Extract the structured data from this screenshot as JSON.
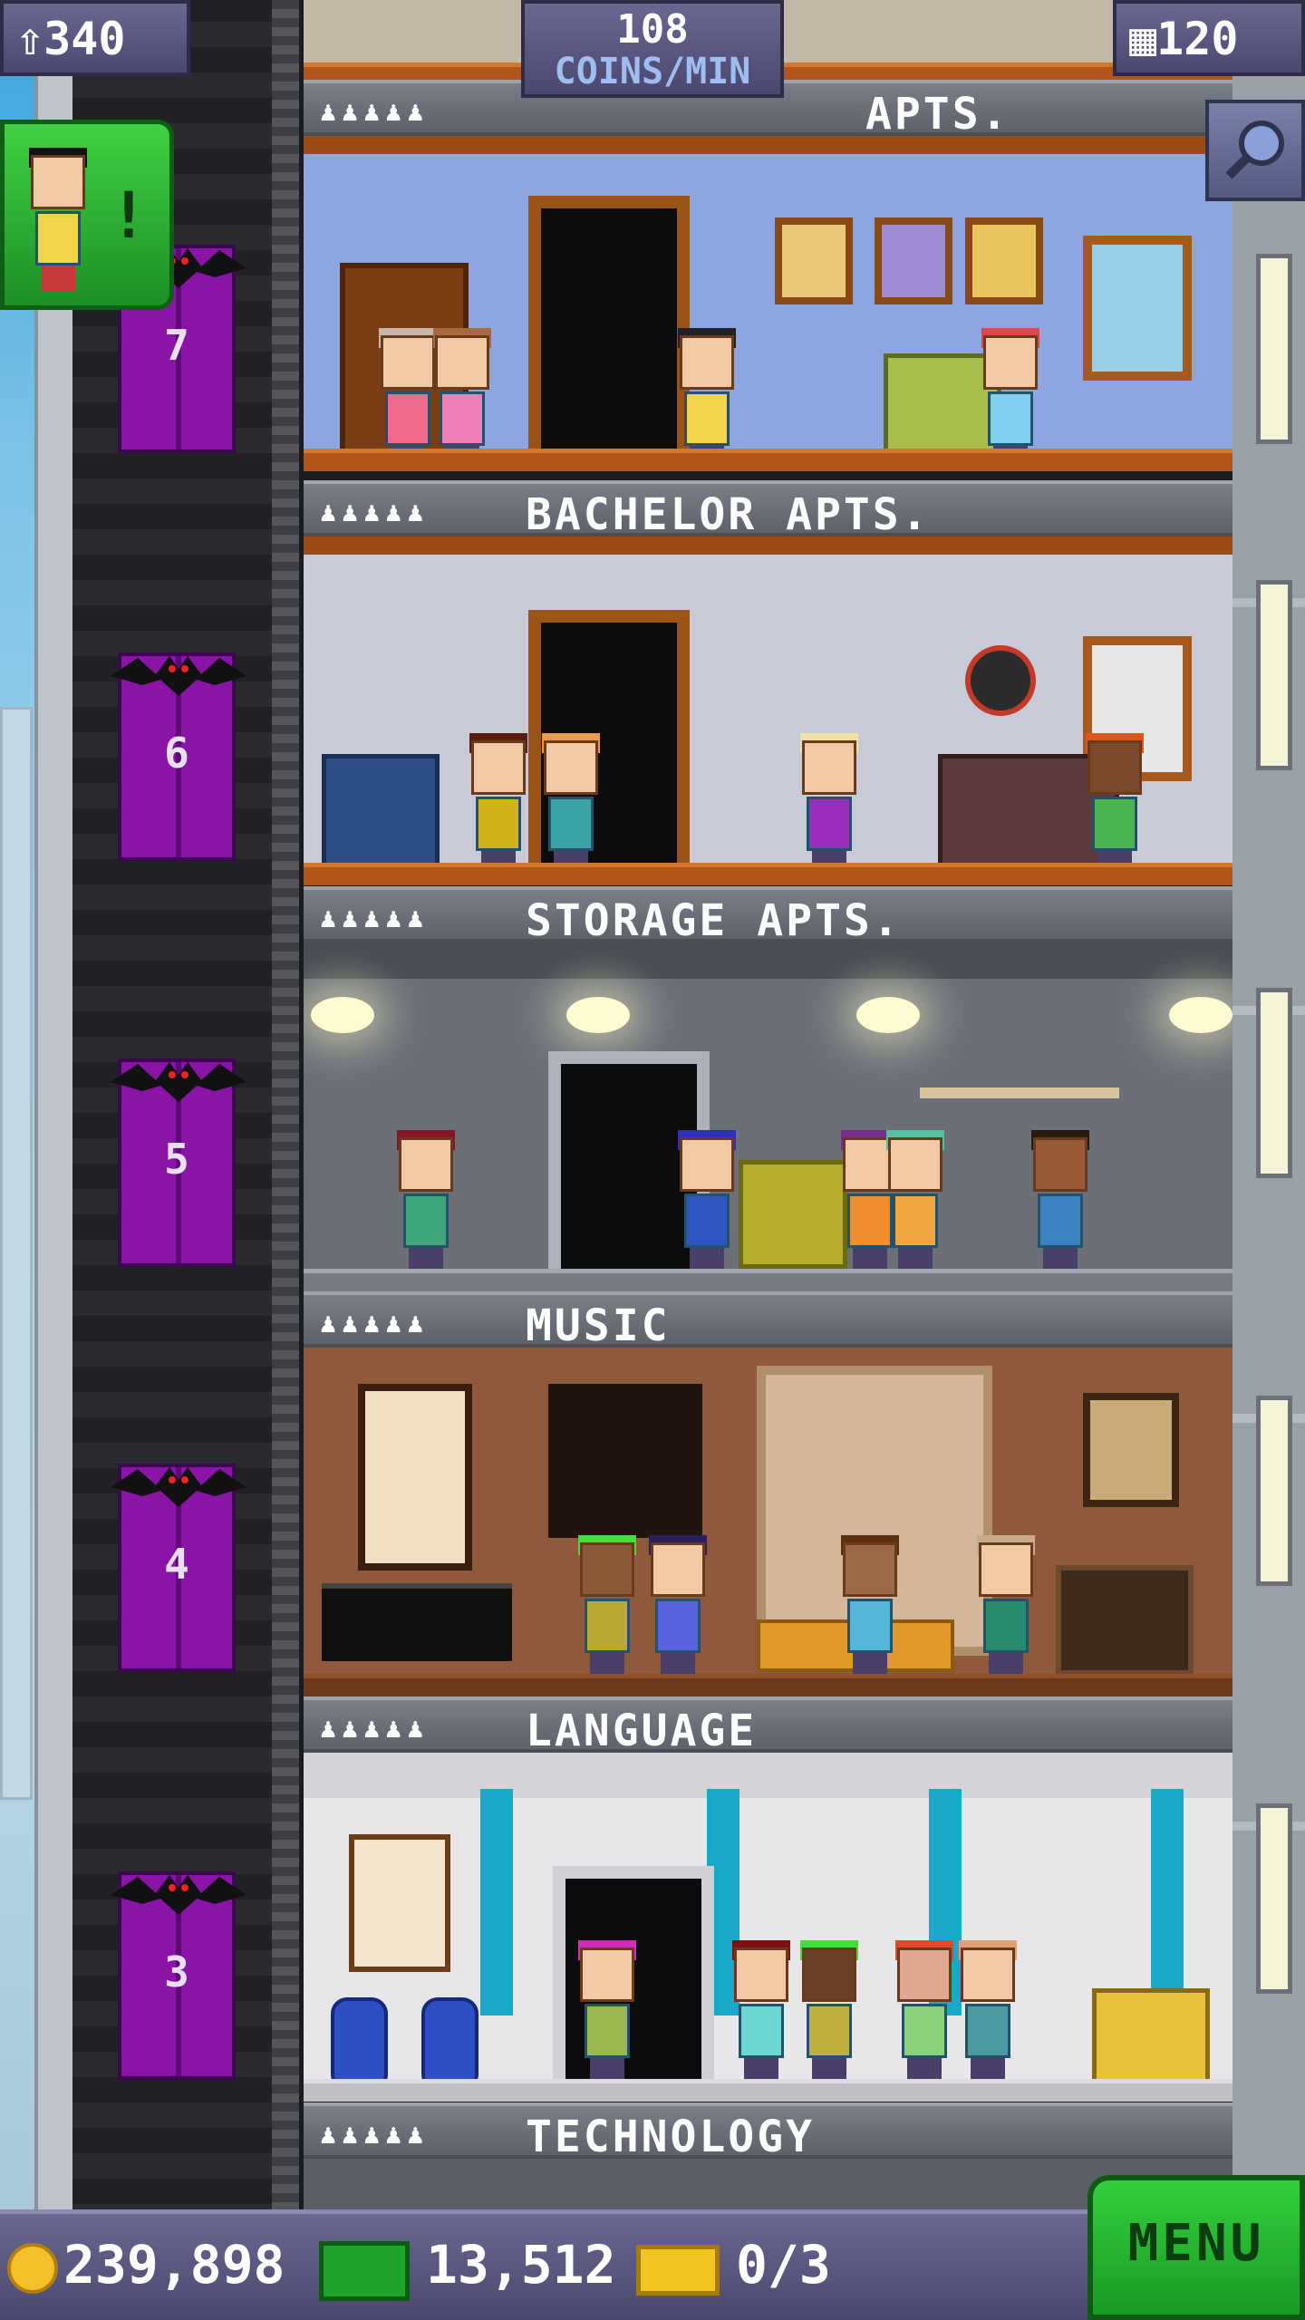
{
  "hud": {
    "population": "340",
    "coins_per_min_value": "108",
    "coins_per_min_unit": "COINS/MIN",
    "floors": "120"
  },
  "floors": [
    {
      "name": "APTS.",
      "people_icons": "♟♟♟♟♟",
      "elevator_number": "7"
    },
    {
      "name": "BACHELOR APTS.",
      "people_icons": "♟♟♟♟♟",
      "elevator_number": "6"
    },
    {
      "name": "STORAGE APTS.",
      "people_icons": "♟♟♟♟♟",
      "elevator_number": "5"
    },
    {
      "name": "MUSIC",
      "people_icons": "♟♟♟♟♟",
      "elevator_number": "4"
    },
    {
      "name": "LANGUAGE",
      "people_icons": "♟♟♟♟♟",
      "elevator_number": "3"
    },
    {
      "name": "TECHNOLOGY",
      "people_icons": "♟♟♟♟♟"
    }
  ],
  "bottom_bar": {
    "coins": "239,898",
    "tower_bux": "13,512",
    "tickets": "0/3",
    "menu_label": "MENU"
  },
  "icons": {
    "population": "person-up-icon",
    "floors": "building-icon",
    "zoom": "magnifier-icon",
    "coins": "coin-icon",
    "bux": "bux-icon",
    "tickets": "ticket-icon"
  },
  "colors": {
    "hud_bg": "#5a5880",
    "menu_green": "#22b82d",
    "elevator_purple": "#8a14a8",
    "wood": "#a85a1c"
  }
}
